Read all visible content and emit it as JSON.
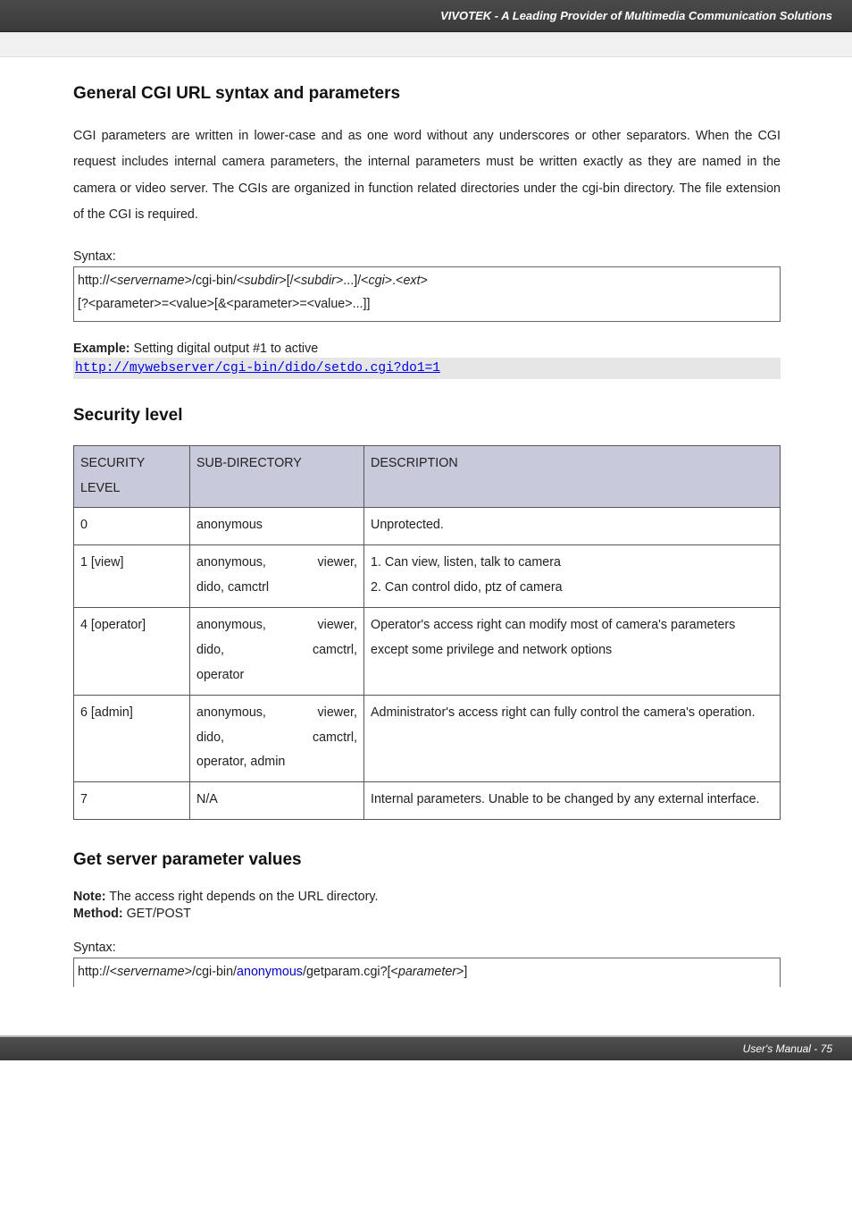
{
  "banner": "VIVOTEK - A Leading Provider of Multimedia Communication Solutions",
  "h_general": "General CGI URL syntax and parameters",
  "p_general": "CGI parameters are written in lower-case and as one word without any underscores or other separators. When the CGI request includes internal camera parameters, the internal parameters must be written exactly as they are named in the camera or video server. The CGIs are organized in function related directories under the cgi-bin directory. The file extension of the CGI is required.",
  "syntax_label": "Syntax:",
  "syntax_box_l1_a": "http://<",
  "syntax_box_l1_b": "servername",
  "syntax_box_l1_c": ">/cgi-bin/<",
  "syntax_box_l1_d": "subdir",
  "syntax_box_l1_e": ">[/<",
  "syntax_box_l1_f": "subdir",
  "syntax_box_l1_g": ">...]/<",
  "syntax_box_l1_h": "cgi",
  "syntax_box_l1_i": ">.<",
  "syntax_box_l1_j": "ext",
  "syntax_box_l1_k": ">",
  "syntax_box_l2": "[?<parameter>=<value>[&<parameter>=<value>...]]",
  "example_bold": "Example:",
  "example_rest": " Setting digital output #1 to active",
  "example_url": "http://mywebserver/cgi-bin/dido/setdo.cgi?do1=1",
  "h_security": "Security level",
  "th1": "SECURITY LEVEL",
  "th2": "SUB-DIRECTORY",
  "th3": "DESCRIPTION",
  "rows": [
    {
      "c1": "0",
      "c2_plain": "anonymous",
      "c3_plain": "Unprotected."
    },
    {
      "c1": "1 [view]",
      "c2_spread": [
        [
          "anonymous,",
          "viewer,"
        ]
      ],
      "c2_last": "dido, camctrl",
      "c3_lines": [
        "1. Can view, listen, talk to camera",
        "2. Can control dido, ptz of camera"
      ]
    },
    {
      "c1": "4 [operator]",
      "c2_spread": [
        [
          "anonymous,",
          "viewer,"
        ],
        [
          "dido,",
          "camctrl,"
        ]
      ],
      "c2_last": "operator",
      "c3_justify": "Operator's access right can modify most of camera's parameters except some privilege and network options"
    },
    {
      "c1": "6 [admin]",
      "c2_spread": [
        [
          "anonymous,",
          "viewer,"
        ],
        [
          "dido,",
          "camctrl,"
        ]
      ],
      "c2_last": "operator, admin",
      "c3_justify": "Administrator's access right can fully control the camera's operation."
    },
    {
      "c1": "7",
      "c2_plain": "N/A",
      "c3_justify": "Internal parameters. Unable to be changed by any external interface."
    }
  ],
  "h_getserver": "Get server parameter values",
  "note_bold": "Note:",
  "note_rest": " The access right depends on the URL directory.",
  "method_bold": "Method:",
  "method_rest": " GET/POST",
  "syntax2_a": "http://<",
  "syntax2_b": "servername",
  "syntax2_c": ">/cgi-bin/",
  "syntax2_d": "anonymous",
  "syntax2_e": "/getparam.cgi?[<",
  "syntax2_f": "parameter",
  "syntax2_g": ">]",
  "footer": "User's Manual - 75"
}
